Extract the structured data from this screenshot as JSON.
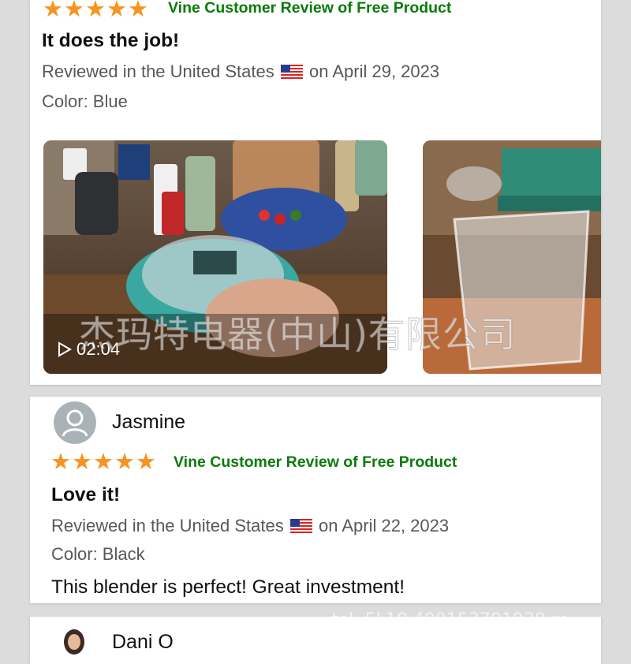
{
  "reviews": [
    {
      "rating": 5,
      "vine_label": "Vine Customer Review of Free Product",
      "title": "It does the job!",
      "reviewed_prefix": "Reviewed in the United States",
      "reviewed_suffix": "on April 29, 2023",
      "color": "Color: Blue",
      "video_duration": "02:04"
    },
    {
      "reviewer": "Jasmine",
      "rating": 5,
      "vine_label": "Vine Customer Review of Free Product",
      "title": "Love it!",
      "reviewed_prefix": "Reviewed in the United States",
      "reviewed_suffix": "on April 22, 2023",
      "color": "Color: Black",
      "body": "This blender is perfect! Great investment!"
    },
    {
      "reviewer": "Dani O"
    }
  ],
  "watermark": "杰玛特电器(中山)有限公司",
  "watermark_phone": "tel: 5L10 400153781938 m",
  "colors": {
    "star": "#f7931e",
    "vine": "#0b7a0b",
    "meta": "#565959"
  }
}
